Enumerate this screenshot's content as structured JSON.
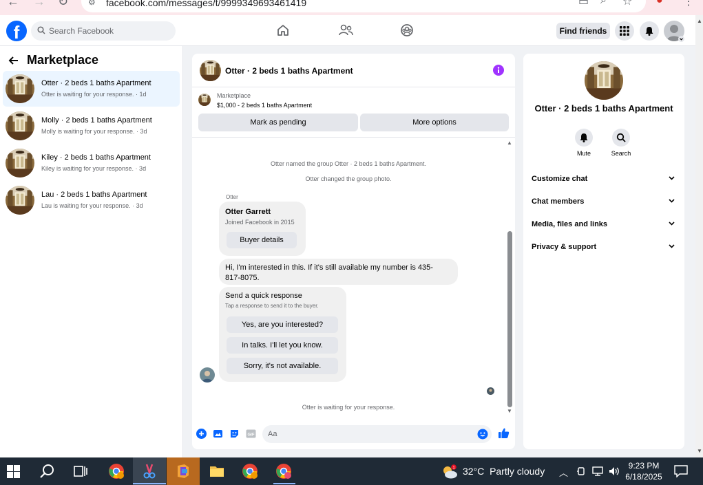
{
  "browser": {
    "url": "facebook.com/messages/t/9999349693461419"
  },
  "header": {
    "search_placeholder": "Search Facebook",
    "find_friends_label": "Find friends"
  },
  "left_panel": {
    "title": "Marketplace",
    "conversations": [
      {
        "name": "Otter · 2 beds 1 baths Apartment",
        "status": "Otter is waiting for your response. · 1d"
      },
      {
        "name": "Molly · 2 beds 1 baths Apartment",
        "status": "Molly is waiting for your response. · 3d"
      },
      {
        "name": "Kiley · 2 beds 1 baths Apartment",
        "status": "Kiley is waiting for your response. · 3d"
      },
      {
        "name": "Lau · 2 beds 1 baths Apartment",
        "status": "Lau is waiting for your response. · 3d"
      }
    ]
  },
  "chat": {
    "title": "Otter · 2 beds 1 baths Apartment",
    "marketplace_label": "Marketplace",
    "listing": "$1,000 - 2 beds 1 baths Apartment",
    "mark_pending_label": "Mark as pending",
    "more_options_label": "More options",
    "system_messages": [
      "Otter named the group Otter · 2 beds 1 baths Apartment.",
      "Otter changed the group photo."
    ],
    "sender_name": "Otter",
    "buyer_card": {
      "name": "Otter Garrett",
      "joined": "Joined Facebook in 2015",
      "button": "Buyer details"
    },
    "message": "Hi, I'm interested in this. If it's still available my number is 435-817-8075.",
    "quick_response": {
      "title": "Send a quick response",
      "hint": "Tap a response to send it to the buyer.",
      "options": [
        "Yes, are you interested?",
        "In talks. I'll let you know.",
        "Sorry, it's not available."
      ]
    },
    "waiting_text": "Otter is waiting for your response.",
    "composer_placeholder": "Aa"
  },
  "right_panel": {
    "title": "Otter · 2 beds 1 baths Apartment",
    "mute_label": "Mute",
    "search_label": "Search",
    "sections": [
      "Customize chat",
      "Chat members",
      "Media, files and links",
      "Privacy & support"
    ]
  },
  "taskbar": {
    "temperature": "32°C",
    "weather": "Partly cloudy",
    "time": "9:23 PM",
    "date": "6/18/2025",
    "badge": "1"
  },
  "colors": {
    "facebook_blue": "#0866ff",
    "info_purple": "#a033ff",
    "active_conversation_bg": "#ebf5ff",
    "taskbar_bg": "#1f2a36"
  }
}
